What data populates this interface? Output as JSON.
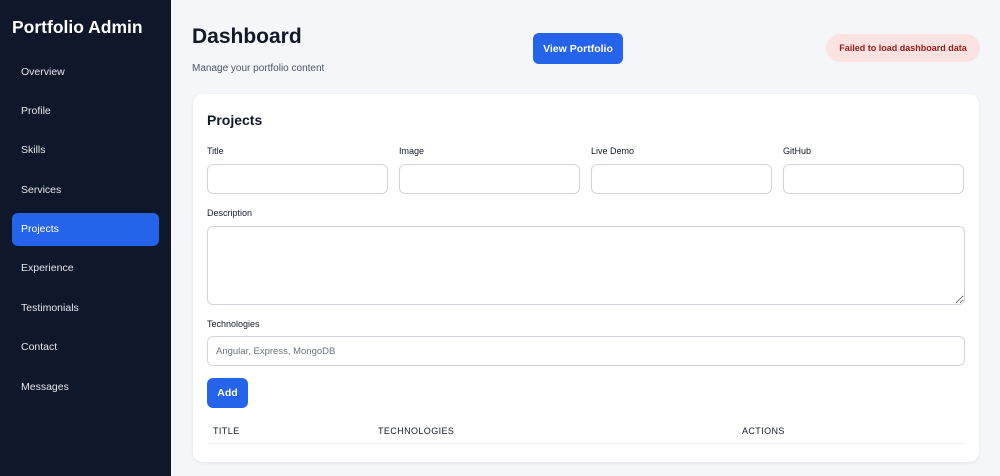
{
  "sidebar": {
    "brand": "Portfolio Admin",
    "items": [
      {
        "label": "Overview"
      },
      {
        "label": "Profile"
      },
      {
        "label": "Skills"
      },
      {
        "label": "Services"
      },
      {
        "label": "Projects",
        "active": true
      },
      {
        "label": "Experience"
      },
      {
        "label": "Testimonials"
      },
      {
        "label": "Contact"
      },
      {
        "label": "Messages"
      }
    ]
  },
  "header": {
    "title": "Dashboard",
    "subtitle": "Manage your portfolio content",
    "view_button": "View Portfolio",
    "error": "Failed to load dashboard data"
  },
  "projects": {
    "title": "Projects",
    "fields": {
      "title_label": "Title",
      "title_value": "",
      "image_label": "Image",
      "image_value": "",
      "live_demo_label": "Live Demo",
      "live_demo_value": "",
      "github_label": "GitHub",
      "github_value": "",
      "description_label": "Description",
      "description_value": "",
      "technologies_label": "Technologies",
      "technologies_placeholder": "Angular, Express, MongoDB",
      "technologies_value": ""
    },
    "add_button": "Add",
    "table": {
      "columns": [
        "TITLE",
        "TECHNOLOGIES",
        "ACTIONS"
      ]
    }
  },
  "colors": {
    "sidebar_bg": "#0f172a",
    "accent": "#2563eb",
    "error_bg": "#fde2e2",
    "error_text": "#991b1b",
    "page_bg": "#f4f6fa"
  }
}
